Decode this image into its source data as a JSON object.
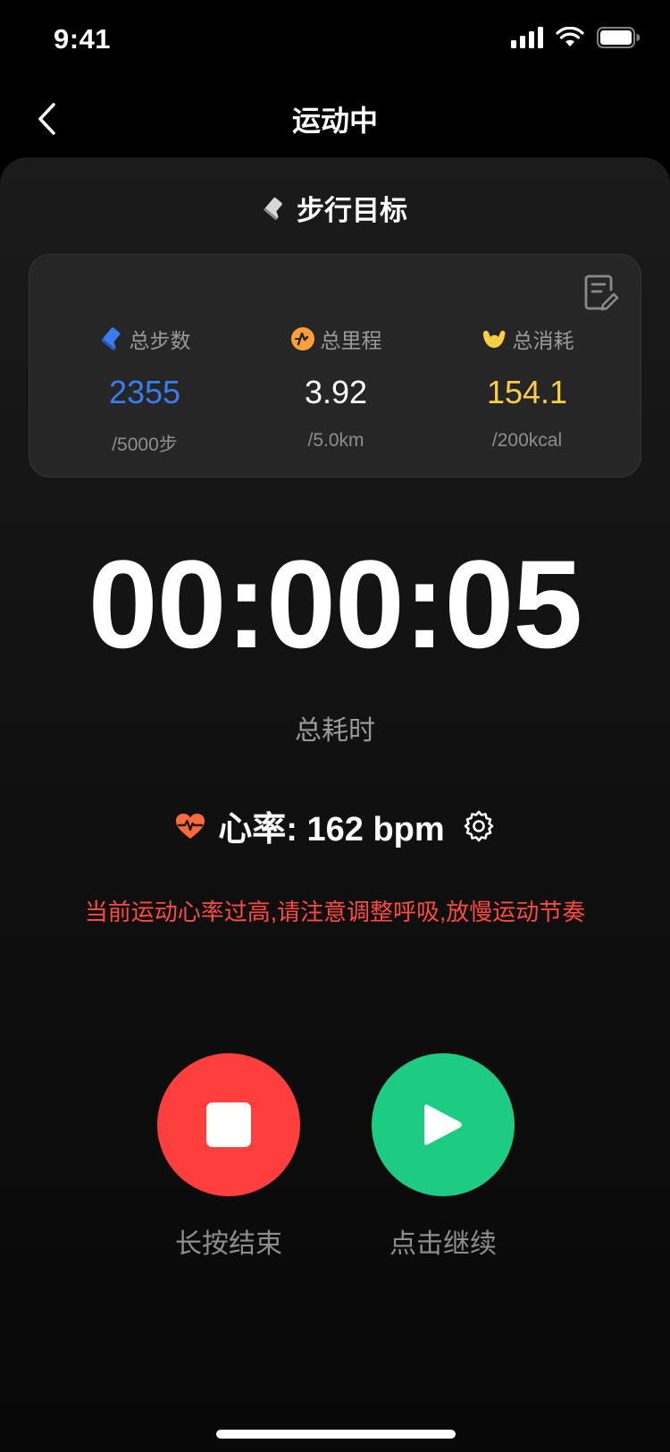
{
  "status_bar": {
    "time": "9:41"
  },
  "nav": {
    "title": "运动中"
  },
  "goal": {
    "title": "步行目标"
  },
  "stats": [
    {
      "label": "总步数",
      "value": "2355",
      "target": "/5000步",
      "color": "#3a7bf0",
      "icon": "shoe-icon"
    },
    {
      "label": "总里程",
      "value": "3.92",
      "target": "/5.0km",
      "color": "#ffffff",
      "icon": "distance-icon"
    },
    {
      "label": "总消耗",
      "value": "154.1",
      "target": "/200kcal",
      "color": "#f7cf45",
      "icon": "muscle-icon"
    }
  ],
  "timer": {
    "value": "00:00:05",
    "label": "总耗时"
  },
  "heart_rate": {
    "text": "心率: 162 bpm",
    "icon": "heart-pulse-icon",
    "color": "#ff6a3c"
  },
  "warning": {
    "text": "当前运动心率过高,请注意调整呼吸,放慢运动节奏",
    "color": "#ff4a3f"
  },
  "controls": {
    "stop_label": "长按结束",
    "stop_color": "#ff3e3e",
    "resume_label": "点击继续",
    "resume_color": "#1ecb82"
  }
}
